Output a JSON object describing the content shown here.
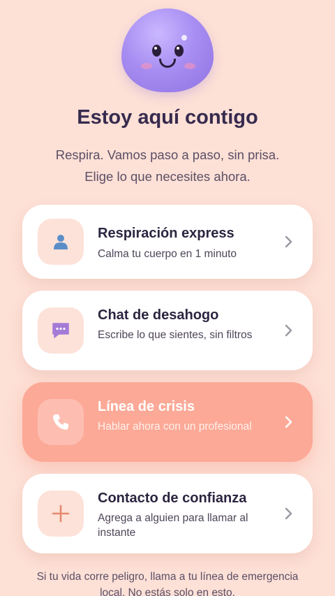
{
  "header": {
    "mascot_icon": "smiling-blob-mascot",
    "title": "Estoy aquí contigo",
    "subtitle_line1": "Respira. Vamos paso a paso, sin prisa.",
    "subtitle_line2": "Elige lo que necesites ahora."
  },
  "options": [
    {
      "icon": "person-icon",
      "title": "Respiración express",
      "desc": "Calma tu cuerpo en 1 minuto"
    },
    {
      "icon": "chat-bubble-icon",
      "title": "Chat de desahogo",
      "desc": "Escribe lo que sientes, sin filtros"
    },
    {
      "icon": "phone-icon",
      "title": "Línea de crisis",
      "desc": "Hablar ahora con un profesional",
      "highlighted": true
    },
    {
      "icon": "plus-icon",
      "title": "Contacto de confianza",
      "desc": "Agrega a alguien para llamar al instante"
    }
  ],
  "footer": {
    "text": "Si tu vida corre peligro, llama a tu línea de emergencia local. No estás solo en esto."
  },
  "colors": {
    "background": "#fde0d6",
    "accent": "#fca997",
    "mascot": "#a88ef2",
    "title_text": "#362a4e"
  }
}
